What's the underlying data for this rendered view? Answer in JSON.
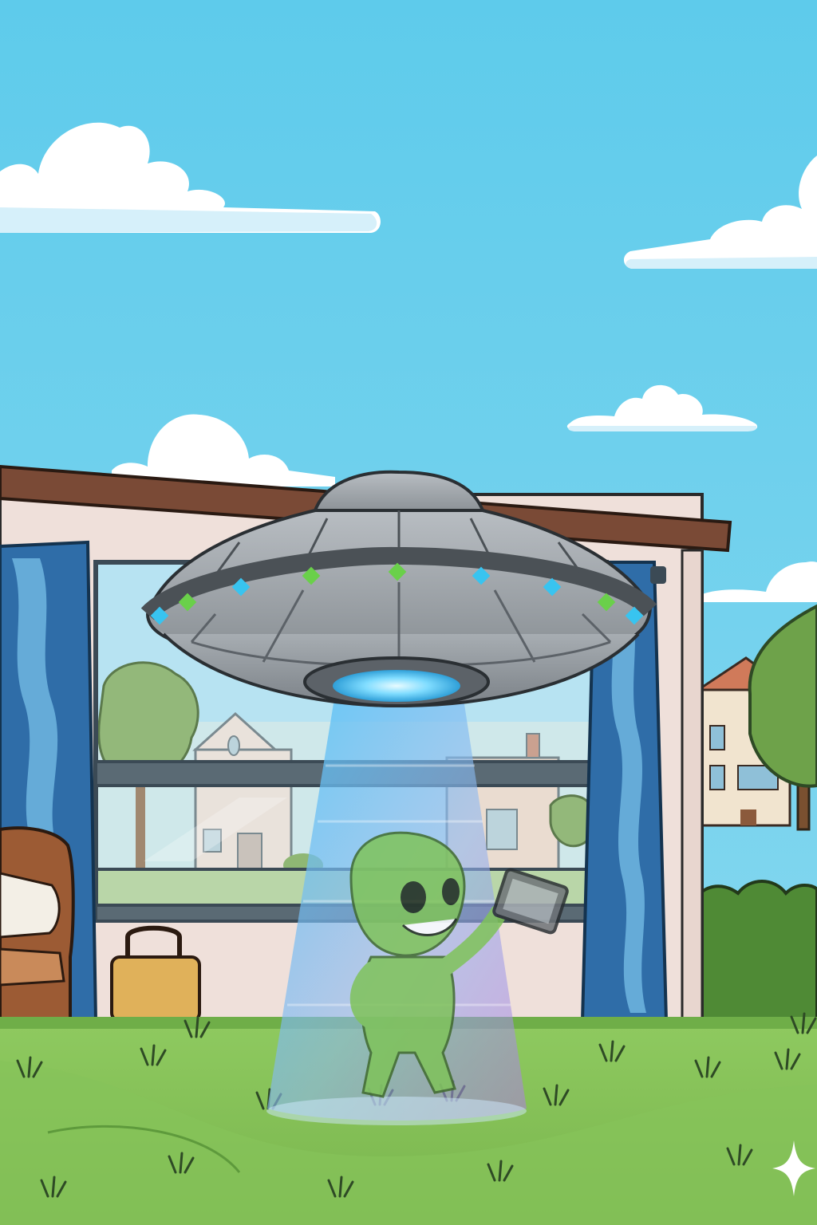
{
  "scene": {
    "palette": {
      "sky_top": "#5ecbeb",
      "sky_bottom": "#8ad9f0",
      "cloud": "#ffffff",
      "cloud_shade": "#d6f0fa",
      "roof": "#7a4a36",
      "wall": "#efe0da",
      "window_frame": "#3b4a55",
      "glass": "#cfe8ea",
      "curtain": "#2f6da8",
      "curtain_light": "#6fb6e0",
      "grass": "#86c35a",
      "grass_dark": "#5e9a3c",
      "grass_stroke": "#2e4a25",
      "bush": "#4f8a35",
      "tree": "#6ea24a",
      "ufo_body": "#9da3a8",
      "ufo_dark": "#5c6268",
      "ufo_light_blue": "#38c4f0",
      "ufo_light_green": "#6ad04a",
      "beam_blue": "#4fc3f7",
      "beam_violet": "#b07be0",
      "alien_green": "#7fc35a",
      "house_wall": "#f1e4cf",
      "house_roof": "#d07a5a",
      "chair": "#9c5b34",
      "bag": "#e0b15a",
      "sparkle": "#ffffff"
    },
    "icons": [
      "sparkle-icon"
    ]
  }
}
